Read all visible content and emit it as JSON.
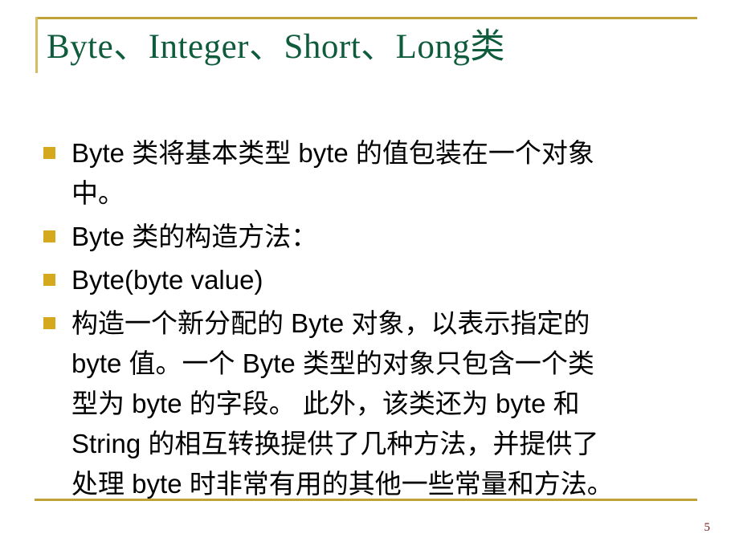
{
  "slide": {
    "title": "Byte、Integer、Short、Long类",
    "page_number": "5",
    "accent_color": "#bfa136",
    "title_color": "#0e5c3c",
    "bullet_color": "#d6a81e",
    "text_color": "#000000",
    "background_color": "#ffffff"
  },
  "bullets": [
    {
      "marker": "square-bullet",
      "text": "Byte 类将基本类型 byte 的值包装在一个对象中。",
      "lines": [
        "Byte 类将基本类型 byte 的值包装在一个对象",
        "中。"
      ]
    },
    {
      "marker": "square-bullet",
      "text": "Byte 类的构造方法：",
      "lines": [
        "Byte 类的构造方法："
      ]
    },
    {
      "marker": "square-bullet",
      "text": "Byte(byte value)",
      "lines": [
        "Byte(byte value)"
      ]
    },
    {
      "marker": "square-bullet",
      "text": "构造一个新分配的 Byte 对象，以表示指定的 byte 值。一个 Byte 类型的对象只包含一个类型为 byte 的字段。 此外，该类还为 byte 和 String 的相互转换提供了几种方法，并提供了处理 byte 时非常有用的其他一些常量和方法。",
      "lines": [
        "构造一个新分配的 Byte 对象，以表示指定的",
        "byte 值。一个 Byte 类型的对象只包含一个类",
        "型为 byte 的字段。 此外，该类还为 byte 和",
        "String 的相互转换提供了几种方法，并提供了",
        "处理 byte 时非常有用的其他一些常量和方法。"
      ]
    }
  ]
}
